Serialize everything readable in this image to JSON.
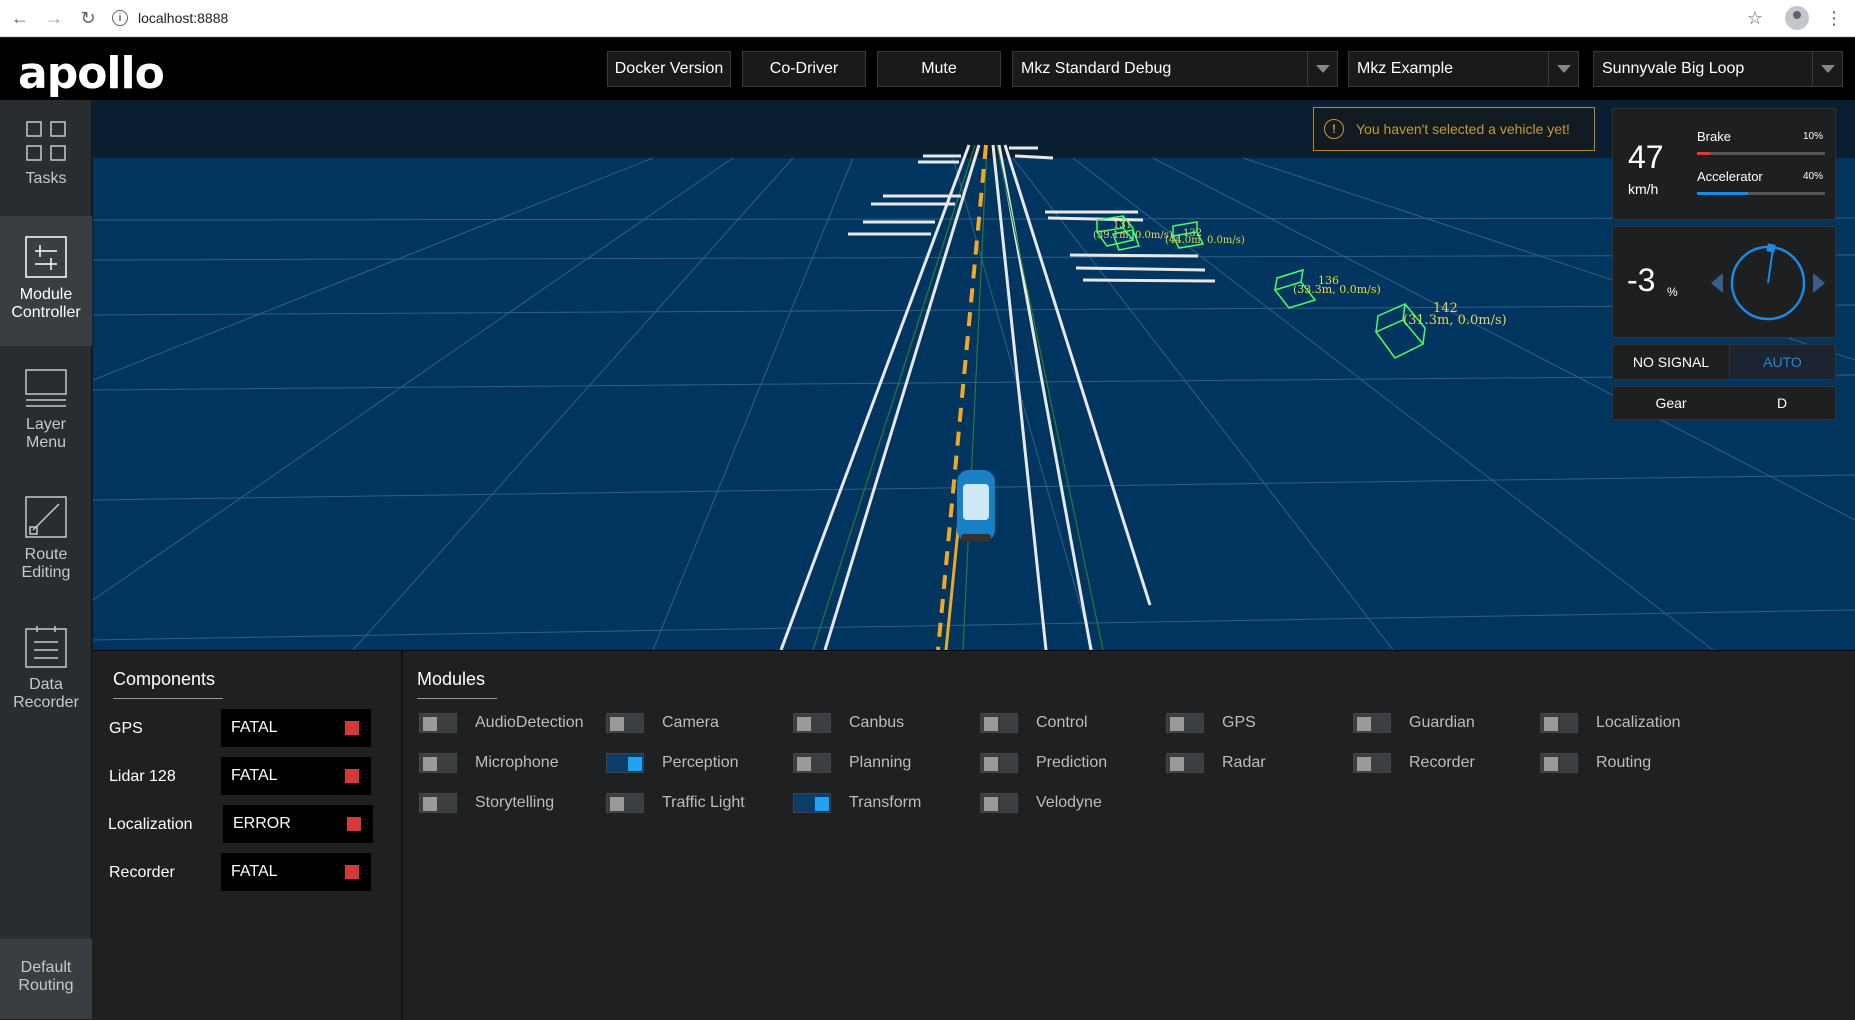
{
  "browser": {
    "url": "localhost:8888"
  },
  "header": {
    "logo": "apollo",
    "buttons": [
      "Docker Version",
      "Co-Driver",
      "Mute"
    ],
    "mode_select": "Mkz Standard Debug",
    "vehicle_select": "Mkz Example",
    "map_select": "Sunnyvale Big Loop"
  },
  "sidebar": {
    "items": [
      {
        "label_line1": "Tasks",
        "label_line2": "",
        "icon": "tasks-grid-icon"
      },
      {
        "label_line1": "Module",
        "label_line2": "Controller",
        "icon": "module-controller-icon"
      },
      {
        "label_line1": "Layer",
        "label_line2": "Menu",
        "icon": "layer-menu-icon"
      },
      {
        "label_line1": "Route",
        "label_line2": "Editing",
        "icon": "route-editing-icon"
      },
      {
        "label_line1": "Data",
        "label_line2": "Recorder",
        "icon": "data-recorder-icon"
      }
    ],
    "active_index": 1,
    "default_routing": {
      "line1": "Default",
      "line2": "Routing"
    }
  },
  "scene": {
    "warning": "You haven't selected a vehicle yet!",
    "obstacles": [
      {
        "id": "131",
        "info": "(39.1m, 0.0m/s)"
      },
      {
        "id": "132",
        "info": "(44.0m, 0.0m/s)"
      },
      {
        "id": "136",
        "info": "(33.3m, 0.0m/s)"
      },
      {
        "id": "142",
        "info": "(31.3m, 0.0m/s)"
      }
    ]
  },
  "dashboard": {
    "speed": "47",
    "speed_unit": "km/h",
    "brake_label": "Brake",
    "brake_pct_text": "10%",
    "brake_fraction": 0.1,
    "accel_label": "Accelerator",
    "accel_pct_text": "40%",
    "accel_fraction": 0.4,
    "steering": "-3",
    "steering_unit": "%",
    "signal": "NO SIGNAL",
    "drive_mode": "AUTO",
    "gear_label": "Gear",
    "gear_value": "D",
    "colors": {
      "brake": "#d33a3a",
      "accel": "#1e88e5",
      "auto": "#1e88e5"
    }
  },
  "components": {
    "title": "Components",
    "rows": [
      {
        "name": "GPS",
        "status": "FATAL"
      },
      {
        "name": "Lidar 128",
        "status": "FATAL"
      },
      {
        "name": "Localization",
        "status": "ERROR"
      },
      {
        "name": "Recorder",
        "status": "FATAL"
      }
    ]
  },
  "modules": {
    "title": "Modules",
    "items": [
      {
        "label": "AudioDetection",
        "on": false
      },
      {
        "label": "Camera",
        "on": false
      },
      {
        "label": "Canbus",
        "on": false
      },
      {
        "label": "Control",
        "on": false
      },
      {
        "label": "GPS",
        "on": false
      },
      {
        "label": "Guardian",
        "on": false
      },
      {
        "label": "Localization",
        "on": false
      },
      {
        "label": "Microphone",
        "on": false
      },
      {
        "label": "Perception",
        "on": true
      },
      {
        "label": "Planning",
        "on": false
      },
      {
        "label": "Prediction",
        "on": false
      },
      {
        "label": "Radar",
        "on": false
      },
      {
        "label": "Recorder",
        "on": false
      },
      {
        "label": "Routing",
        "on": false
      },
      {
        "label": "Storytelling",
        "on": false
      },
      {
        "label": "Traffic Light",
        "on": false
      },
      {
        "label": "Transform",
        "on": true
      },
      {
        "label": "Velodyne",
        "on": false
      }
    ]
  }
}
